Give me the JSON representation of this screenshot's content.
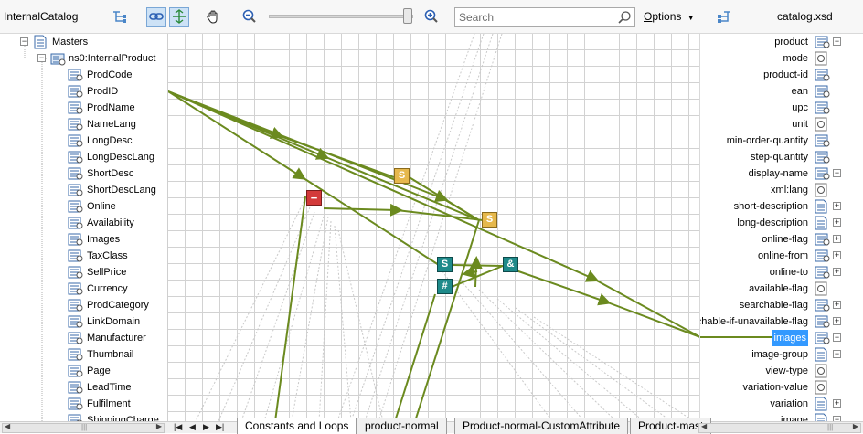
{
  "toolbar": {
    "left_title": "InternalCatalog",
    "right_title": "catalog.xsd",
    "search_placeholder": "Search",
    "options_label": "Options",
    "options_accel": "O",
    "options_rest": "ptions",
    "zoom_level": 1.0
  },
  "source_tree": {
    "root": "Masters",
    "child": "ns0:InternalProduct",
    "items": [
      "ProdCode",
      "ProdID",
      "ProdName",
      "NameLang",
      "LongDesc",
      "LongDescLang",
      "ShortDesc",
      "ShortDescLang",
      "Online",
      "Availability",
      "Images",
      "TaxClass",
      "SellPrice",
      "Currency",
      "ProdCategory",
      "LinkDomain",
      "Manufacturer",
      "Thumbnail",
      "Page",
      "LeadTime",
      "Fulfilment",
      "ShippingCharge"
    ]
  },
  "target_tree": {
    "items": [
      {
        "label": "product",
        "icon": "element-icon",
        "expander": "minus"
      },
      {
        "label": "mode",
        "icon": "attribute-icon",
        "expander": ""
      },
      {
        "label": "product-id",
        "icon": "element-icon",
        "expander": ""
      },
      {
        "label": "ean",
        "icon": "element-icon",
        "expander": ""
      },
      {
        "label": "upc",
        "icon": "element-icon",
        "expander": ""
      },
      {
        "label": "unit",
        "icon": "attribute-icon",
        "expander": ""
      },
      {
        "label": "min-order-quantity",
        "icon": "element-icon",
        "expander": ""
      },
      {
        "label": "step-quantity",
        "icon": "element-icon",
        "expander": ""
      },
      {
        "label": "display-name",
        "icon": "element-icon",
        "expander": "minus"
      },
      {
        "label": "xml:lang",
        "icon": "attribute-icon",
        "expander": ""
      },
      {
        "label": "short-description",
        "icon": "document-icon",
        "expander": "plus"
      },
      {
        "label": "long-description",
        "icon": "document-icon",
        "expander": "plus"
      },
      {
        "label": "online-flag",
        "icon": "element-icon",
        "expander": "plus"
      },
      {
        "label": "online-from",
        "icon": "element-icon",
        "expander": "plus"
      },
      {
        "label": "online-to",
        "icon": "element-icon",
        "expander": "plus"
      },
      {
        "label": "available-flag",
        "icon": "attribute-icon",
        "expander": ""
      },
      {
        "label": "searchable-flag",
        "icon": "element-icon",
        "expander": "plus"
      },
      {
        "label": "rchable-if-unavailable-flag",
        "icon": "element-icon",
        "expander": "plus"
      },
      {
        "label": "images",
        "icon": "element-icon",
        "expander": "minus",
        "selected": true
      },
      {
        "label": "image-group",
        "icon": "document-icon",
        "expander": "minus"
      },
      {
        "label": "view-type",
        "icon": "attribute-icon",
        "expander": ""
      },
      {
        "label": "variation-value",
        "icon": "attribute-icon",
        "expander": ""
      },
      {
        "label": "variation",
        "icon": "document-icon",
        "expander": "plus"
      },
      {
        "label": "image",
        "icon": "document-icon",
        "expander": "minus"
      }
    ]
  },
  "functions": [
    {
      "name": "concat-function-1",
      "glyph": "S",
      "color": "#e6b84c"
    },
    {
      "name": "concat-function-2",
      "glyph": "S",
      "color": "#e6b84c"
    },
    {
      "name": "subtract-function",
      "glyph": "−",
      "color": "#d33a3a"
    },
    {
      "name": "string-function",
      "glyph": "S",
      "color": "#1e8a8a"
    },
    {
      "name": "number-function",
      "glyph": "#",
      "color": "#1e8a8a"
    },
    {
      "name": "logical-and-function",
      "glyph": "&",
      "color": "#1e8a8a"
    }
  ],
  "tabs": [
    "Constants and Loops",
    "product-normal",
    "Product-normal-CustomAttribute",
    "Product-mast"
  ],
  "colors": {
    "link": "#6b8a1f",
    "selection": "#3399ff",
    "accent": "#4a86c8"
  }
}
